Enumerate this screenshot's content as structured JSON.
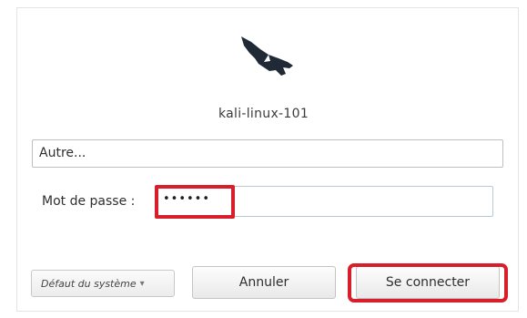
{
  "hostname": "kali-linux-101",
  "logo": {
    "icon": "kali-dragon-icon",
    "color": "#1f2a36"
  },
  "user_field": {
    "value": "Autre..."
  },
  "password": {
    "label": "Mot de passe :",
    "masked_value": "••••••"
  },
  "session": {
    "label": "Défaut du système",
    "icon": "chevron-down-icon"
  },
  "buttons": {
    "cancel": "Annuler",
    "login": "Se connecter"
  },
  "colors": {
    "highlight": "#d81e2a"
  }
}
